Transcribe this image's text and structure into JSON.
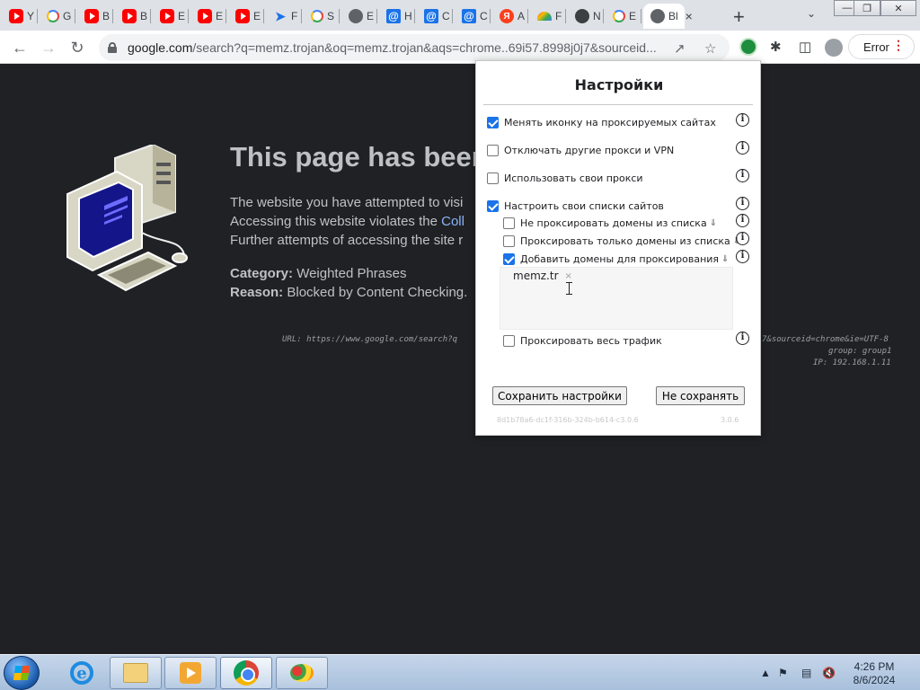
{
  "tabs": [
    {
      "icon": "youtube-icon",
      "letter": "Y"
    },
    {
      "icon": "google-icon",
      "letter": "G"
    },
    {
      "icon": "youtube-icon",
      "letter": "B"
    },
    {
      "icon": "youtube-icon",
      "letter": "B"
    },
    {
      "icon": "youtube-icon",
      "letter": "E"
    },
    {
      "icon": "youtube-icon",
      "letter": "E"
    },
    {
      "icon": "youtube-icon",
      "letter": "E"
    },
    {
      "icon": "arrow-icon",
      "letter": "F"
    },
    {
      "icon": "google-icon",
      "letter": "S"
    },
    {
      "icon": "globe-icon",
      "letter": "E"
    },
    {
      "icon": "mail-at-icon",
      "letter": "H"
    },
    {
      "icon": "mail-at-icon",
      "letter": "C"
    },
    {
      "icon": "mail-at-icon",
      "letter": "C"
    },
    {
      "icon": "yandex-icon",
      "letter": "A"
    },
    {
      "icon": "rainbow-icon",
      "letter": "F"
    },
    {
      "icon": "github-icon",
      "letter": "N"
    },
    {
      "icon": "google-icon",
      "letter": "E"
    },
    {
      "icon": "blocked-page-icon",
      "letter": "Bl",
      "active": true
    }
  ],
  "toolbar": {
    "url_host": "google.com",
    "url_rest": "/search?q=memz.trojan&oq=memz.trojan&aqs=chrome..69i57.8998j0j7&sourceid...",
    "error_label": "Error"
  },
  "blocked_page": {
    "headline": "This page has been",
    "line1": "The website you have attempted to visi",
    "line2_prefix": "Accessing this website violates the ",
    "line2_link": "Coll",
    "line3": "Further attempts of accessing the site r",
    "category_label": "Category:",
    "category_value": "Weighted Phrases",
    "reason_label": "Reason:",
    "reason_value": "Blocked by Content Checking.",
    "url_line": "URL: https://www.google.com/search?q",
    "url_tail": "7&sourceid=chrome&ie=UTF-8",
    "group_line": "group: group1",
    "ip_line": "IP: 192.168.1.11"
  },
  "popup": {
    "title": "Настройки",
    "options": [
      {
        "label": "Менять иконку на проксируемых сайтах",
        "checked": true
      },
      {
        "label": "Отключать другие прокси и VPN",
        "checked": false
      },
      {
        "label": "Использовать свои прокси",
        "checked": false
      },
      {
        "label": "Настроить свои списки сайтов",
        "checked": true
      },
      {
        "label": "Не проксировать домены из списка",
        "checked": false
      },
      {
        "label": "Проксировать только домены из списка",
        "checked": false
      },
      {
        "label": "Добавить домены для проксирования",
        "checked": true
      },
      {
        "label": "Проксировать весь трафик",
        "checked": false
      }
    ],
    "domain_chip": "memz.tr",
    "save_label": "Сохранить настройки",
    "cancel_label": "Не сохранять",
    "footer_id": "8d1b78a6-dc1f-316b-324b-b614-c3.0.6",
    "footer_version": "3.0.6"
  },
  "taskbar": {
    "time": "4:26 PM",
    "date": "8/6/2024"
  }
}
